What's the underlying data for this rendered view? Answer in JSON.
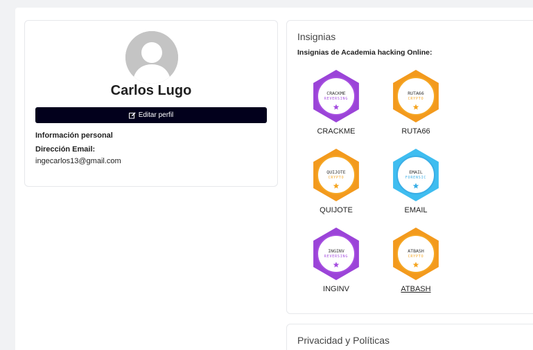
{
  "profile": {
    "name": "Carlos Lugo",
    "edit_label": "Editar perfil",
    "edit_icon": "edit-icon",
    "info_title": "Información personal",
    "email_label": "Dirección Email:",
    "email_value": "ingecarlos13@gmail.com"
  },
  "badges": {
    "title": "Insignias",
    "subtitle": "Insignias de Academia hacking Online:",
    "items": [
      {
        "label": "CRACKME",
        "line1": "CRACKME",
        "line2": "REVERSING",
        "color": "#9b44d8",
        "accent": "#a64ee0",
        "link": false
      },
      {
        "label": "RUTA66",
        "line1": "RUTA66",
        "line2": "CRYPTO",
        "color": "#f39a1d",
        "accent": "#f5a623",
        "link": false
      },
      {
        "label": "QUIJOTE",
        "line1": "QUIJOTE",
        "line2": "CRYPTO",
        "color": "#f39a1d",
        "accent": "#f5a623",
        "link": false
      },
      {
        "label": "EMAIL",
        "line1": "EMAIL",
        "line2": "FORENSIC",
        "color": "#3fbdf0",
        "accent": "#3aaee6",
        "link": false
      },
      {
        "label": "INGINV",
        "line1": "INGINV",
        "line2": "REVERSING",
        "color": "#9b44d8",
        "accent": "#a64ee0",
        "link": false
      },
      {
        "label": "ATBASH",
        "line1": "ATBASH",
        "line2": "CRYPTO",
        "color": "#f39a1d",
        "accent": "#f5a623",
        "link": true
      }
    ]
  },
  "privacy": {
    "title": "Privacidad y Políticas"
  }
}
